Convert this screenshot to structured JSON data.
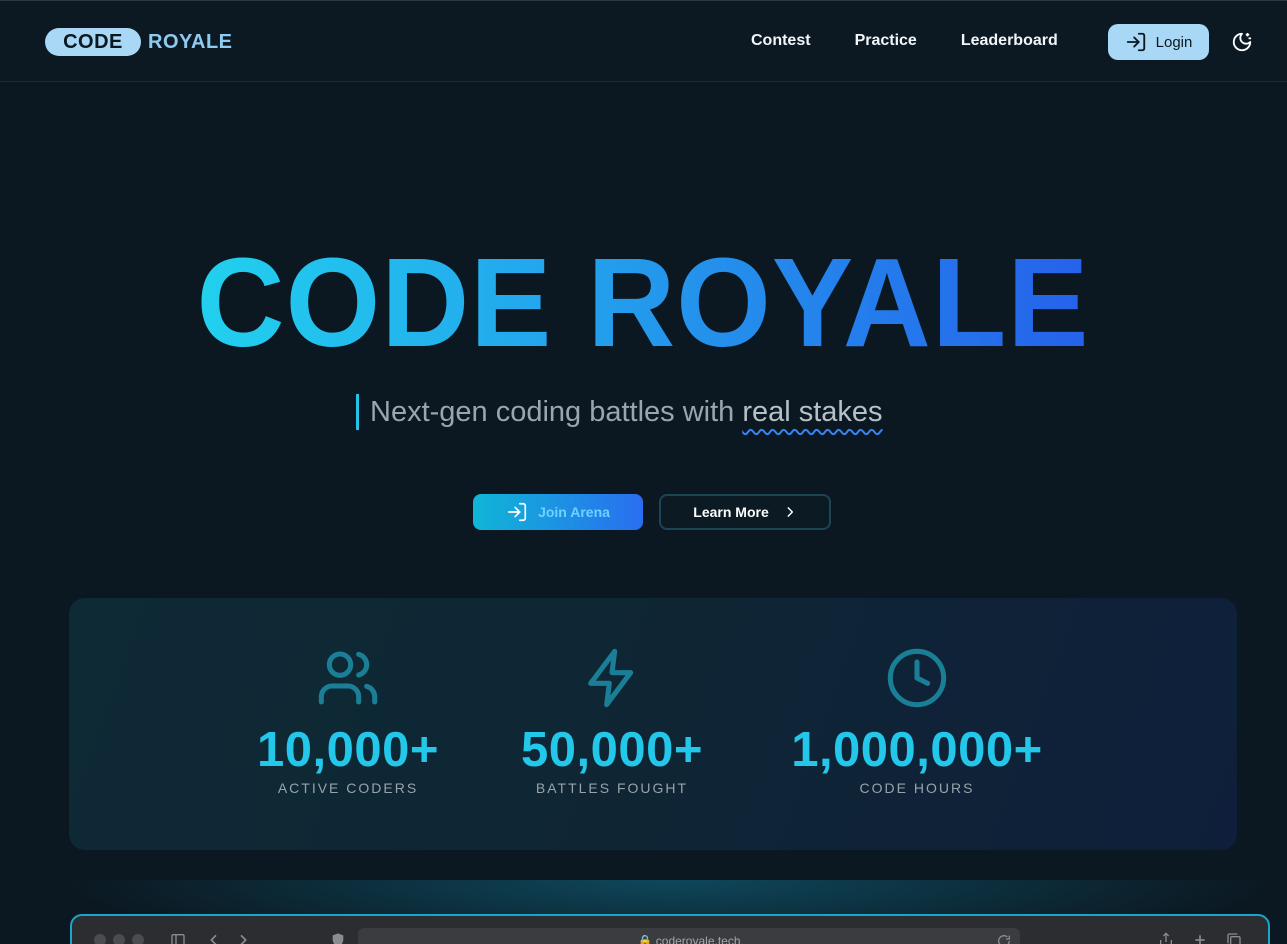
{
  "brand": {
    "logo_pill": "CODE",
    "logo_rest": "ROYALE"
  },
  "nav": {
    "items": [
      {
        "label": "Contest"
      },
      {
        "label": "Practice"
      },
      {
        "label": "Leaderboard"
      }
    ],
    "login_label": "Login",
    "login_icon": "login-icon",
    "theme_icon": "moon-stars-icon"
  },
  "hero": {
    "title": "CODE ROYALE",
    "gradient": [
      "#22d3ee",
      "#2563eb"
    ],
    "tagline_prefix": "Next-gen coding battles with",
    "tagline_highlight": "real stakes",
    "primary_cta": "Join Arena",
    "secondary_cta": "Learn More"
  },
  "stats": [
    {
      "icon": "users-icon",
      "value": "10,000+",
      "label": "ACTIVE CODERS"
    },
    {
      "icon": "lightning-icon",
      "value": "50,000+",
      "label": "BATTLES FOUGHT"
    },
    {
      "icon": "clock-icon",
      "value": "1,000,000+",
      "label": "CODE HOURS"
    }
  ],
  "mockup": {
    "address": "coderoyale.tech"
  },
  "colors": {
    "accent": "#23c7ea",
    "bg": "#0b1821",
    "pill": "#a8d8f5"
  }
}
